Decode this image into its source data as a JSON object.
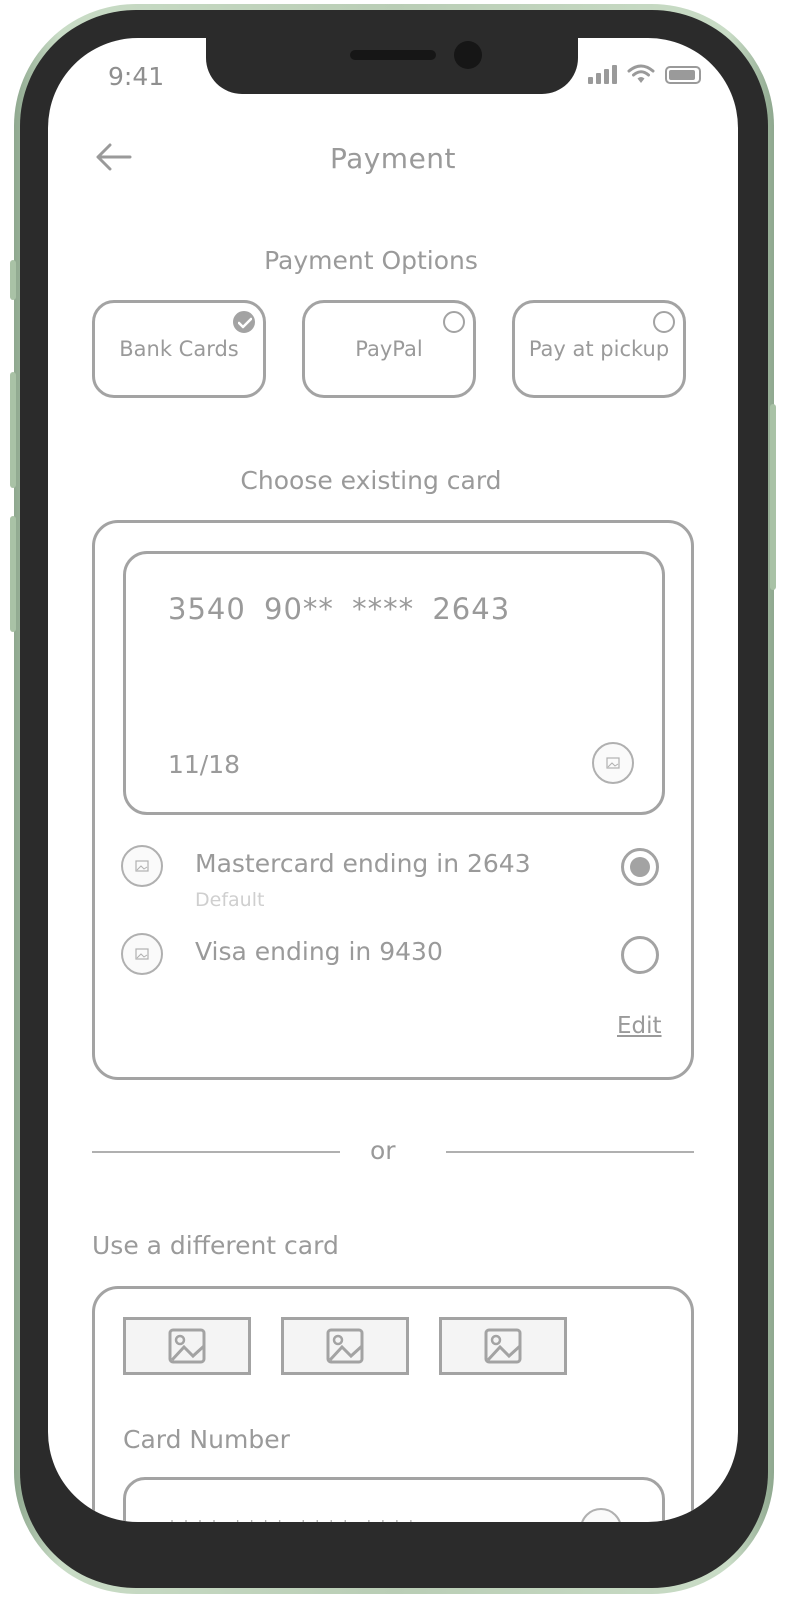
{
  "status_bar": {
    "time": "9:41"
  },
  "header": {
    "title": "Payment"
  },
  "payment_options": {
    "title": "Payment Options",
    "options": [
      {
        "label": "Bank Cards",
        "selected": true
      },
      {
        "label": "PayPal",
        "selected": false
      },
      {
        "label": "Pay at pickup",
        "selected": false
      }
    ]
  },
  "existing_card": {
    "title": "Choose existing card",
    "card_number": "3540 90** **** 2643",
    "card_expiry": "11/18",
    "saved_cards": [
      {
        "name": "Mastercard ending in 2643",
        "sub": "Default",
        "selected": true
      },
      {
        "name": "Visa ending in 9430",
        "sub": "",
        "selected": false
      }
    ],
    "edit_label": "Edit"
  },
  "divider": {
    "label": "or"
  },
  "new_card": {
    "title": "Use a different card",
    "card_number_label": "Card Number",
    "card_number_placeholder": "**** **** **** ****"
  },
  "colors": {
    "stroke": "#a3a3a3",
    "text": "#9a9a9a",
    "muted": "#cfcfcf",
    "frame": "#2b2b2b",
    "case": "#b9cdb5"
  }
}
